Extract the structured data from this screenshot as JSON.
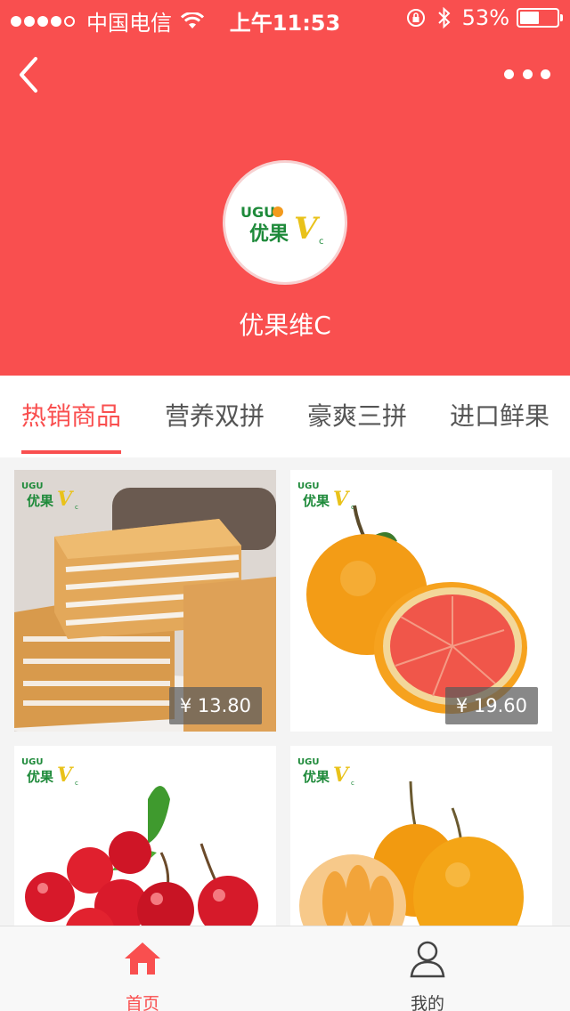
{
  "status_bar": {
    "carrier": "中国电信",
    "time": "上午11:53",
    "battery": "53%",
    "battery_level": 0.53
  },
  "header": {
    "store_name": "优果维C",
    "logo_text_top": "UGU",
    "logo_text_bottom": "优果",
    "logo_letter": "V",
    "logo_sub": "c"
  },
  "tabs": [
    {
      "label": "热销商品",
      "active": true
    },
    {
      "label": "营养双拼",
      "active": false
    },
    {
      "label": "豪爽三拼",
      "active": false
    },
    {
      "label": "进口鲜果",
      "active": false
    }
  ],
  "products": [
    {
      "name": "cake",
      "price": "¥ 13.80"
    },
    {
      "name": "blood-orange",
      "price": "¥ 19.60"
    },
    {
      "name": "cherries",
      "price": ""
    },
    {
      "name": "oranges",
      "price": ""
    }
  ],
  "tabbar": [
    {
      "label": "首页",
      "icon": "home-icon",
      "active": true
    },
    {
      "label": "我的",
      "icon": "user-icon",
      "active": false
    }
  ],
  "colors": {
    "brand": "#f94f4f",
    "logo_green": "#1e8a3a",
    "logo_yellow": "#e9c21a"
  }
}
